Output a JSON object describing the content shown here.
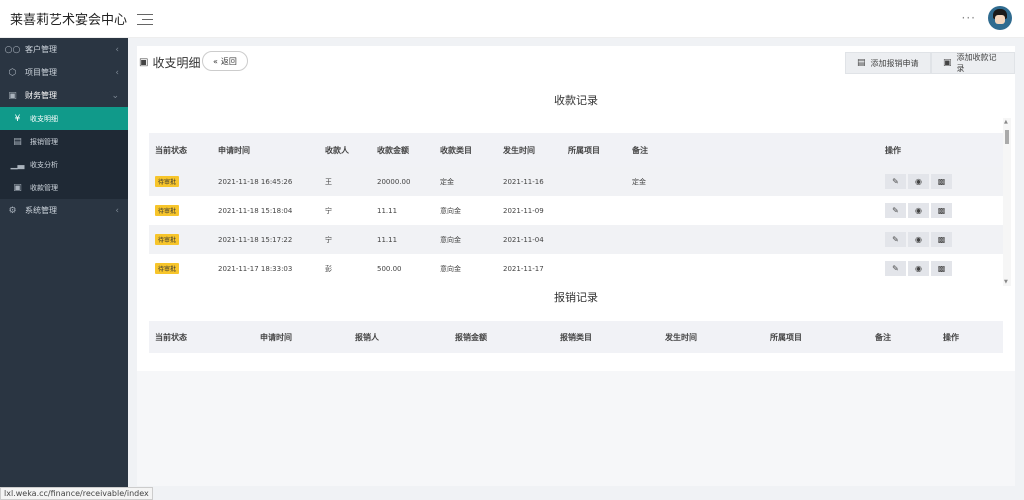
{
  "app": {
    "title": "莱喜莉艺术宴会中心"
  },
  "sidebar": {
    "items": [
      {
        "label": "客户管理",
        "icon": "users-icon"
      },
      {
        "label": "项目管理",
        "icon": "cube-icon"
      },
      {
        "label": "财务管理",
        "icon": "cash-icon"
      }
    ],
    "finance_sub": [
      {
        "label": "收支明细",
        "icon": "yen-icon"
      },
      {
        "label": "报销管理",
        "icon": "car-icon"
      },
      {
        "label": "收支分析",
        "icon": "bar-chart-icon"
      },
      {
        "label": "收款管理",
        "icon": "cash-icon"
      }
    ],
    "system": {
      "label": "系统管理",
      "icon": "gear-icon"
    }
  },
  "statusbar": {
    "url": "lxl.weka.cc/finance/receivable/index"
  },
  "page": {
    "title": "收支明细",
    "back_label": "返回",
    "add_reimburse_label": "添加报销申请",
    "add_receipt_label": "添加收款记录"
  },
  "receipts": {
    "title": "收款记录",
    "columns": [
      "当前状态",
      "申请时间",
      "收款人",
      "收款金额",
      "收款类目",
      "发生时间",
      "所属项目",
      "备注",
      "操作"
    ],
    "rows": [
      {
        "status": "待审批",
        "apply_time": "2021-11-18 16:45:26",
        "payee": "王",
        "amount": "20000.00",
        "category": "定金",
        "occur_time": "2021-11-16",
        "project": "",
        "note": "定金"
      },
      {
        "status": "待审批",
        "apply_time": "2021-11-18 15:18:04",
        "payee": "宁",
        "amount": "11.11",
        "category": "意向金",
        "occur_time": "2021-11-09",
        "project": "",
        "note": ""
      },
      {
        "status": "待审批",
        "apply_time": "2021-11-18 15:17:22",
        "payee": "宁",
        "amount": "11.11",
        "category": "意向金",
        "occur_time": "2021-11-04",
        "project": "",
        "note": ""
      },
      {
        "status": "待审批",
        "apply_time": "2021-11-17 18:33:03",
        "payee": "彭",
        "amount": "500.00",
        "category": "意向金",
        "occur_time": "2021-11-17",
        "project": "",
        "note": ""
      }
    ]
  },
  "reimbursements": {
    "title": "报销记录",
    "columns": [
      "当前状态",
      "申请时间",
      "报销人",
      "报销金额",
      "报销类目",
      "发生时间",
      "所属项目",
      "备注",
      "操作"
    ]
  }
}
